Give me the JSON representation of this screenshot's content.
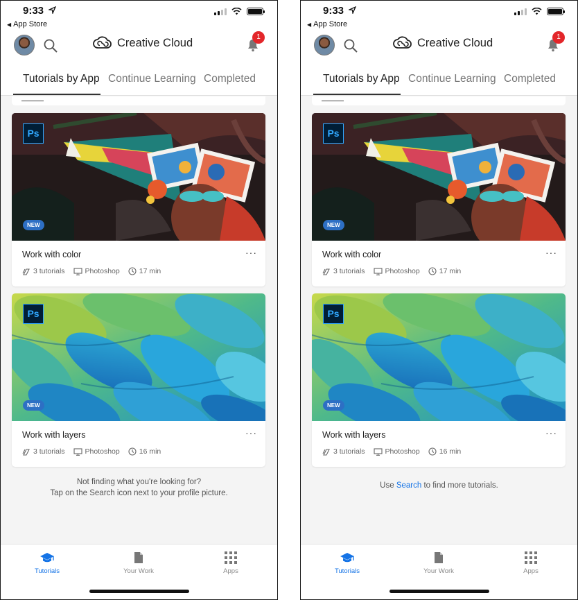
{
  "status_bar": {
    "time": "9:33",
    "back_label": "App Store"
  },
  "header": {
    "app_name": "Creative Cloud",
    "notification_count": "1"
  },
  "tabs": [
    {
      "label": "Tutorials by App",
      "active": true
    },
    {
      "label": "Continue Learning",
      "active": false
    },
    {
      "label": "Completed",
      "active": false
    }
  ],
  "cards": [
    {
      "app_badge": "Ps",
      "tag": "NEW",
      "title": "Work with color",
      "more": "···",
      "tutorial_count": "3 tutorials",
      "app_name": "Photoshop",
      "duration": "17 min"
    },
    {
      "app_badge": "Ps",
      "tag": "NEW",
      "title": "Work with layers",
      "more": "···",
      "tutorial_count": "3 tutorials",
      "app_name": "Photoshop",
      "duration": "16 min"
    }
  ],
  "footer_left": {
    "line1": "Not finding what you're looking for?",
    "line2": "Tap on the Search icon next to your profile picture."
  },
  "footer_right": {
    "pre": "Use ",
    "link": "Search",
    "post": " to find more tutorials."
  },
  "tabbar": [
    {
      "label": "Tutorials",
      "icon": "graduation-cap-icon",
      "active": true
    },
    {
      "label": "Your Work",
      "icon": "document-icon",
      "active": false
    },
    {
      "label": "Apps",
      "icon": "grid-icon",
      "active": false
    }
  ],
  "colors": {
    "accent": "#1473e6",
    "badge_red": "#e3262a",
    "ps_blue": "#31a8ff",
    "ps_dark": "#001e36",
    "new_pill": "#2d6fc4"
  }
}
